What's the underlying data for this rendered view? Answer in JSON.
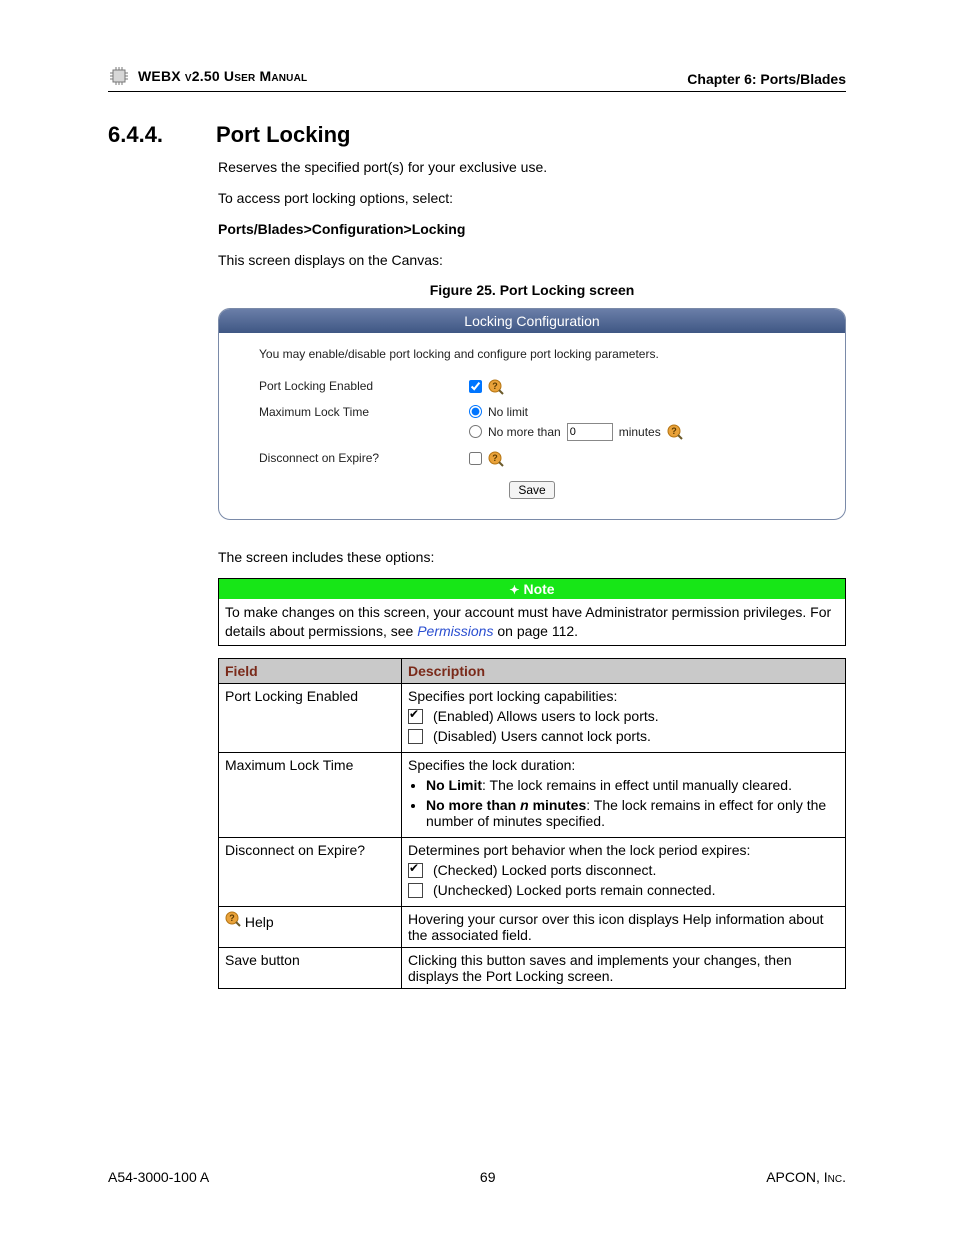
{
  "header": {
    "left": "WEBX v2.50 User Manual",
    "right": "Chapter 6: Ports/Blades"
  },
  "section": {
    "number": "6.4.4.",
    "title": "Port Locking",
    "para1": "Reserves the specified port(s) for your exclusive use.",
    "para2": "To access port locking options, select:",
    "breadcrumb": "Ports/Blades>Configuration>Locking",
    "para3": "This screen displays on the Canvas:",
    "figure_caption": "Figure 25. Port Locking screen"
  },
  "panel": {
    "title": "Locking Configuration",
    "intro": "You may enable/disable port locking and configure port locking parameters.",
    "row1_label": "Port Locking Enabled",
    "row2_label": "Maximum Lock Time",
    "row2_opt1": "No limit",
    "row2_opt2_pre": "No more than",
    "row2_opt2_value": "0",
    "row2_opt2_post": "minutes",
    "row3_label": "Disconnect on Expire?",
    "save": "Save"
  },
  "after_panel": "The screen includes these options:",
  "note": {
    "title": "Note",
    "body_pre": "To make changes on this screen, your account must have Administrator permission privileges. For details about permissions, see ",
    "link": "Permissions",
    "body_post": " on page 112."
  },
  "table": {
    "h1": "Field",
    "h2": "Description",
    "r1_field": "Port Locking Enabled",
    "r1_line0": "Specifies port locking capabilities:",
    "r1_line1": "(Enabled) Allows users to lock ports.",
    "r1_line2": "(Disabled) Users cannot lock ports.",
    "r2_field": "Maximum Lock Time",
    "r2_line0": "Specifies the lock duration:",
    "r2_b1_bold": "No Limit",
    "r2_b1_rest": ": The lock remains in effect until manually cleared.",
    "r2_b2_bold_pre": "No more than ",
    "r2_b2_bold_var": "n",
    "r2_b2_bold_post": " minutes",
    "r2_b2_rest": ": The lock remains in effect for only the number of minutes specified.",
    "r3_field": "Disconnect on Expire?",
    "r3_line0": "Determines port behavior when the lock period expires:",
    "r3_line1": "(Checked) Locked ports disconnect.",
    "r3_line2": "(Unchecked) Locked ports remain connected.",
    "r4_field": "Help",
    "r4_desc": "Hovering your cursor over this icon displays Help information about the associated field.",
    "r5_field": "Save button",
    "r5_desc": "Clicking this button saves and implements your changes, then displays the Port Locking screen."
  },
  "footer": {
    "left": "A54-3000-100 A",
    "center": "69",
    "right": "APCON, Inc."
  }
}
